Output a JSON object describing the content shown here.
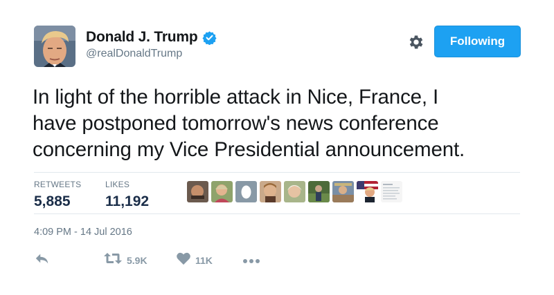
{
  "author": {
    "name": "Donald J. Trump",
    "handle": "@realDonaldTrump",
    "verified": true
  },
  "follow_button": {
    "label": "Following"
  },
  "tweet": {
    "lines": [
      "In light of the horrible attack in Nice, France, I",
      "have postponed tomorrow's news conference",
      "concerning my Vice Presidential announcement."
    ],
    "timestamp": "4:09 PM - 14 Jul 2016"
  },
  "stats": {
    "retweets_label": "RETWEETS",
    "retweets_value": "5,885",
    "likes_label": "LIKES",
    "likes_value": "11,192"
  },
  "actions": {
    "retweet_count": "5.9K",
    "like_count": "11K"
  },
  "colors": {
    "accent": "#1da1f2",
    "muted": "#657786",
    "text": "#14171a"
  }
}
